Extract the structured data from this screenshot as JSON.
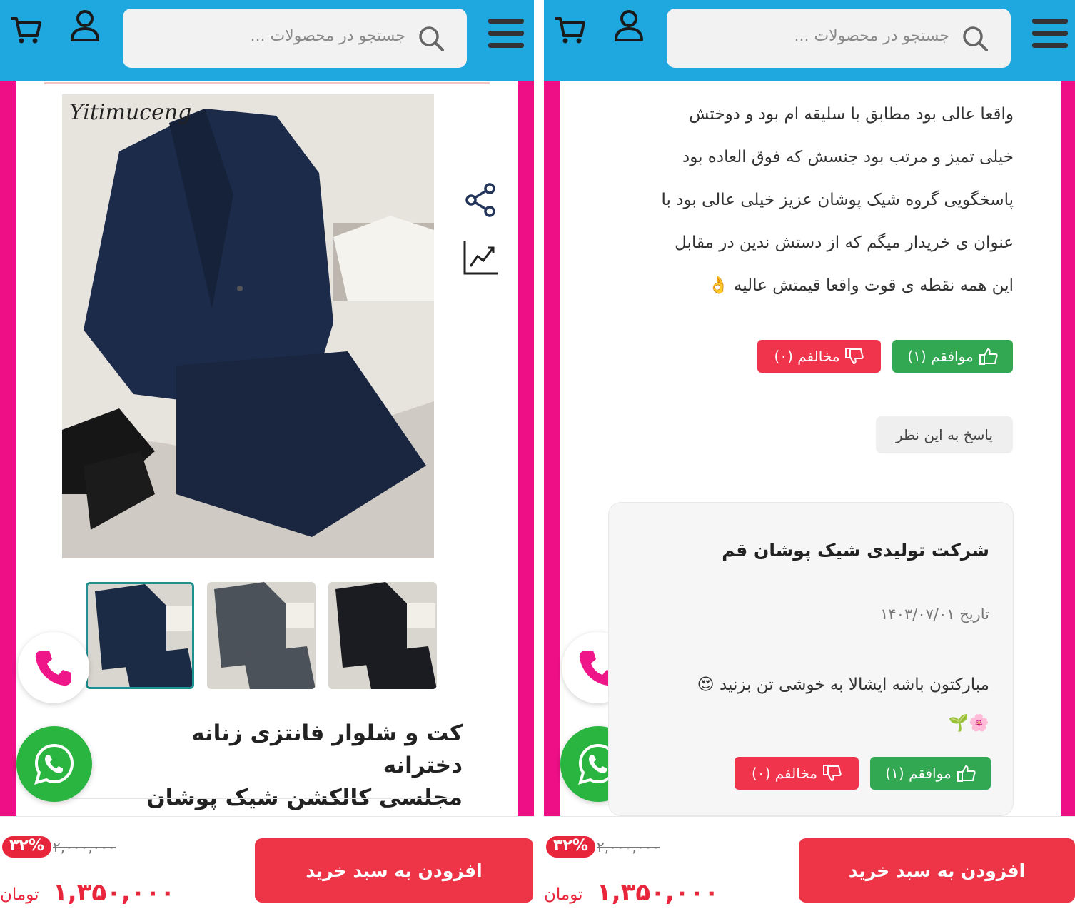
{
  "colors": {
    "header": "#1fa8df",
    "side_bar": "#ee0f86",
    "accent_red": "#ed3547",
    "agree_green": "#33a852",
    "disagree_red": "#f0344b",
    "whatsapp_green": "#2ab540",
    "phone_pink": "#ee1688"
  },
  "header": {
    "search_placeholder": "جستجو در محصولات ...",
    "icons": [
      "cart-icon",
      "user-icon",
      "search-icon",
      "menu-icon"
    ]
  },
  "product": {
    "title_line1": "کت و شلوار فانتزی زنانه دخترانه",
    "title_line2": "مجلسی کالکشن شیک پوشان",
    "image_watermark": "Yitimuceng",
    "thumbnails": [
      {
        "color": "#1b2b45",
        "label": "navy"
      },
      {
        "color": "#4c5259",
        "label": "grey"
      },
      {
        "color": "#1a1c22",
        "label": "black"
      }
    ],
    "side_icons": [
      "share-icon",
      "chart-icon"
    ]
  },
  "footer": {
    "discount_badge": "۳۲%",
    "old_price": "۲,۰۰۰,۰۰۰",
    "price": "۱,۳۵۰,۰۰۰",
    "currency": "تومان",
    "add_to_cart": "افزودن به سبد خرید"
  },
  "review": {
    "lines": [
      "واقعا عالی بود مطابق با سلیقه ام بود و دوختش",
      "خیلی تمیز و مرتب بود جنسش که فوق العاده بود",
      "پاسخگویی گروه شیک پوشان عزیز خیلی عالی بود با",
      "عنوان ی خریدار میگم که از دستش ندین در مقابل",
      "این همه نقطه ی قوت واقعا قیمتش عالیه 👌"
    ],
    "agree": "موافقم (۱)",
    "disagree": "مخالفم (۰)",
    "reply": "پاسخ به این نظر"
  },
  "answer": {
    "author": "شرکت تولیدی شیک پوشان قم",
    "date": "تاریخ ۱۴۰۳/۰۷/۰۱",
    "text_line1": "مبارکتون باشه ایشالا به خوشی تن بزنید 😍",
    "text_line2": "🌸🌱",
    "agree": "موافقم (۱)",
    "disagree": "مخالفم (۰)"
  }
}
